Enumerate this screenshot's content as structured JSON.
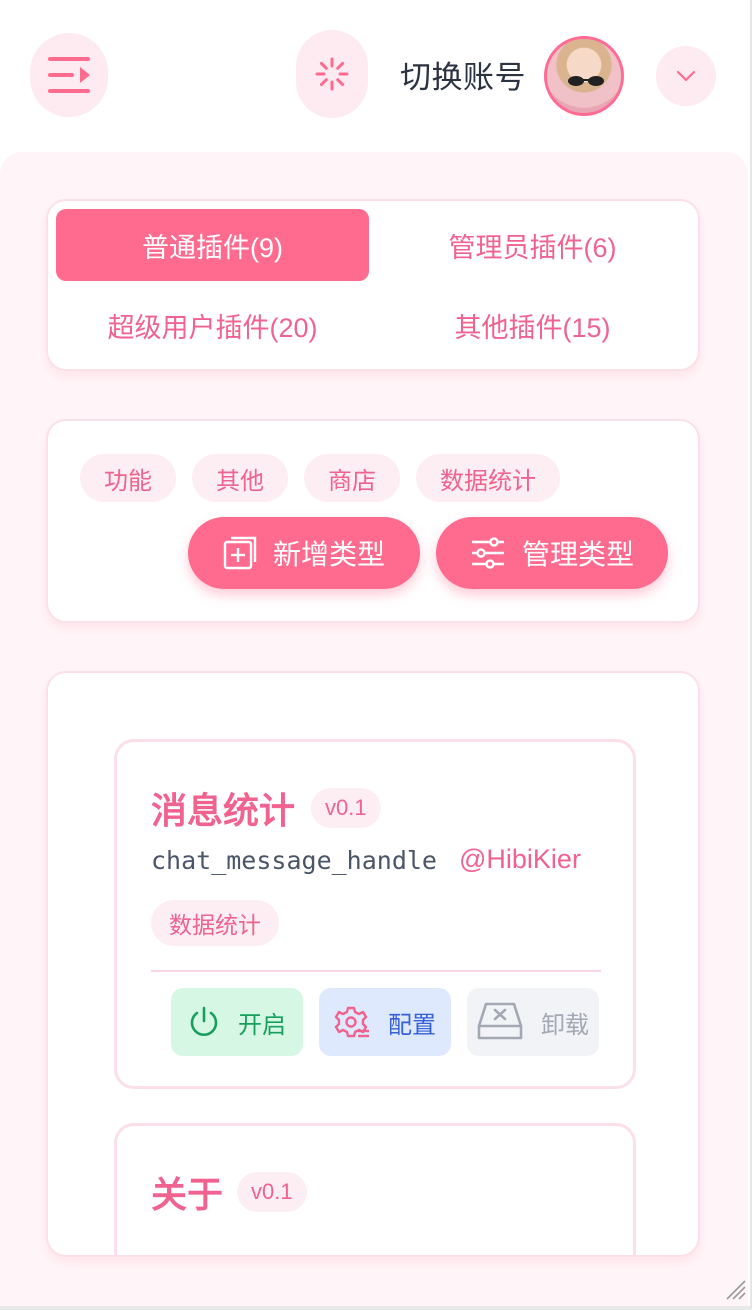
{
  "header": {
    "switch_account_label": "切换账号",
    "menu_icon": "menu-collapse-icon",
    "loading_icon": "loading-spinner-icon",
    "dropdown_icon": "chevron-down-icon"
  },
  "tabs": [
    {
      "label": "普通插件(9)",
      "active": true
    },
    {
      "label": "管理员插件(6)",
      "active": false
    },
    {
      "label": "超级用户插件(20)",
      "active": false
    },
    {
      "label": "其他插件(15)",
      "active": false
    }
  ],
  "types": {
    "chips": [
      "功能",
      "其他",
      "商店",
      "数据统计"
    ],
    "add_label": "新增类型",
    "manage_label": "管理类型"
  },
  "plugins": [
    {
      "title": "消息统计",
      "version": "v0.1",
      "module": "chat_message_handle",
      "author": "@HibiKier",
      "category": "数据统计",
      "actions": {
        "enable": "开启",
        "config": "配置",
        "uninstall": "卸载"
      }
    },
    {
      "title": "关于",
      "version": "v0.1"
    }
  ],
  "colors": {
    "accent": "#ff6b8f",
    "accent_text": "#f0628f",
    "soft_pink": "#fdeef3",
    "enable_bg": "#d6f7e4",
    "config_bg": "#dfe9fd",
    "uninstall_bg": "#f2f3f6"
  }
}
